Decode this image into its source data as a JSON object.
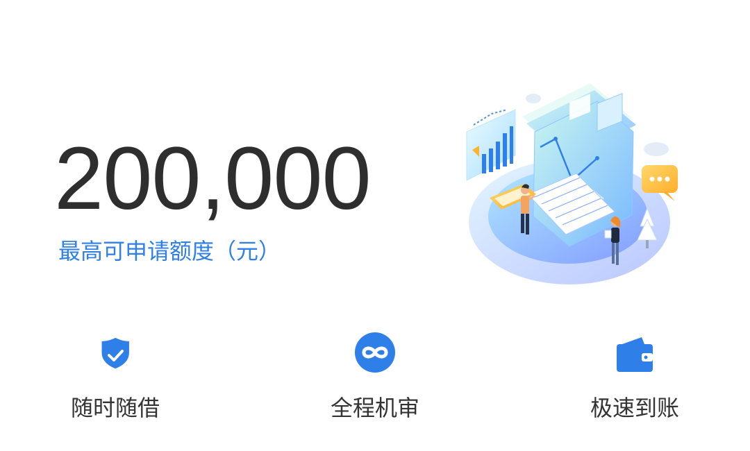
{
  "credit": {
    "amount": "200,000",
    "label": "最高可申请额度（元）"
  },
  "features": [
    {
      "icon": "shield-check-icon",
      "label": "随时随借"
    },
    {
      "icon": "infinity-icon",
      "label": "全程机审"
    },
    {
      "icon": "wallet-icon",
      "label": "极速到账"
    }
  ],
  "colors": {
    "accent": "#2f7fe8",
    "amount_text": "#2e2e2e",
    "feature_text": "#333333"
  }
}
